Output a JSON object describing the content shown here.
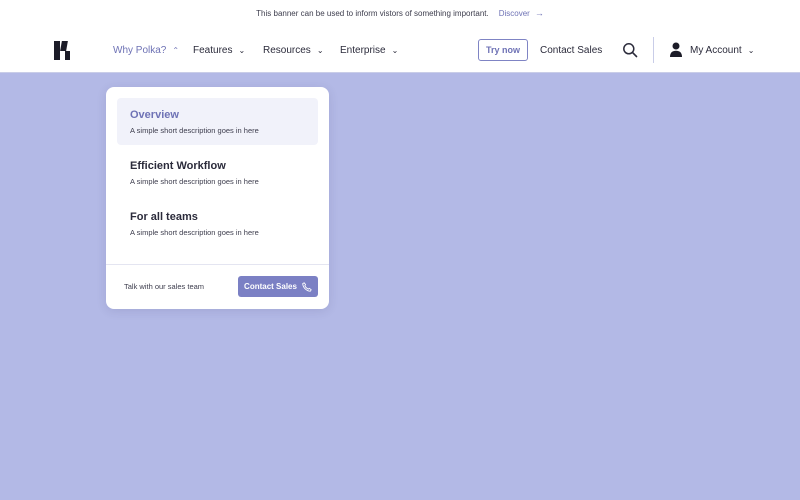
{
  "banner": {
    "message": "This banner can be used to inform vistors of something important.",
    "link_label": "Discover",
    "link_arrow": "→"
  },
  "nav": {
    "items": [
      {
        "label": "Why Polka?",
        "chevron": "⌃"
      },
      {
        "label": "Features",
        "chevron": "⌄"
      },
      {
        "label": "Resources",
        "chevron": "⌄"
      },
      {
        "label": "Enterprise",
        "chevron": "⌄"
      }
    ],
    "try_label": "Try now",
    "contact_label": "Contact Sales",
    "account_label": "My Account",
    "account_chevron": "⌄"
  },
  "dropdown": {
    "items": [
      {
        "title": "Overview",
        "desc": "A simple short description goes in here"
      },
      {
        "title": "Efficient Workflow",
        "desc": "A simple short description goes in here"
      },
      {
        "title": "For all teams",
        "desc": "A simple short description goes in here"
      }
    ],
    "footer_text": "Talk with our sales team",
    "contact_label": "Contact Sales"
  },
  "colors": {
    "accent": "#6e72b5",
    "background": "#b3b9e6",
    "button": "#7b80c4"
  },
  "icons": {
    "logo": "polka-logo",
    "search": "search-icon",
    "user": "user-icon",
    "phone": "phone-icon"
  }
}
